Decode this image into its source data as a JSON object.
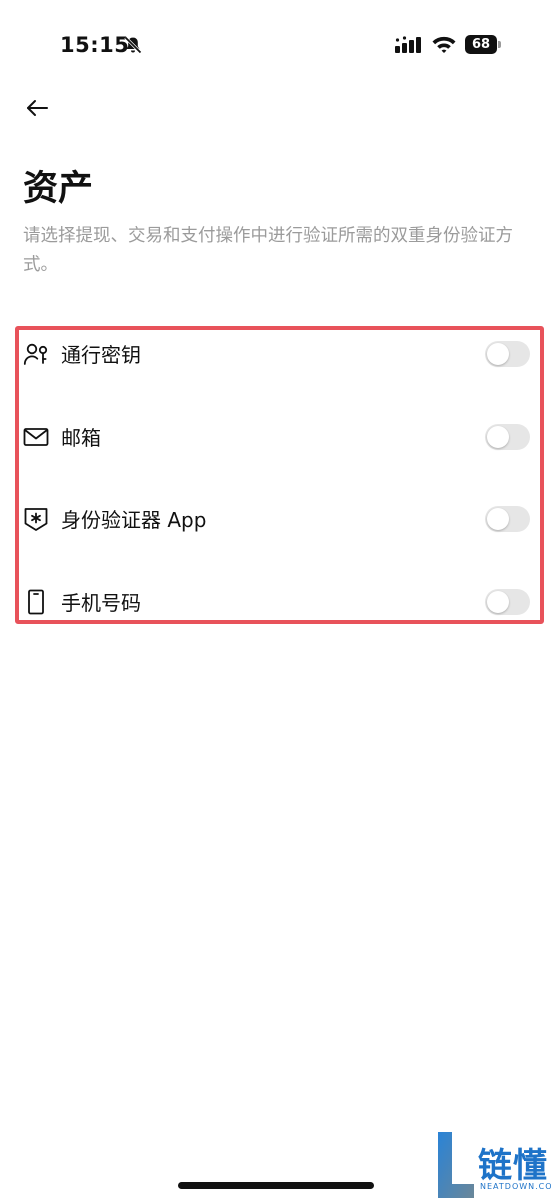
{
  "status_bar": {
    "time": "15:15",
    "battery": "68",
    "icons": [
      "bell-slash-icon",
      "signal-icon",
      "wifi-icon",
      "battery-icon"
    ]
  },
  "header": {
    "back_icon": "arrow-left-icon",
    "title": "资产",
    "description": "请选择提现、交易和支付操作中进行验证所需的双重身份验证方式。"
  },
  "options": [
    {
      "label": "通行密钥",
      "icon": "passkey-icon",
      "enabled": false
    },
    {
      "label": "邮箱",
      "icon": "mail-icon",
      "enabled": false
    },
    {
      "label": "身份验证器 App",
      "icon": "authenticator-shield-icon",
      "enabled": false
    },
    {
      "label": "手机号码",
      "icon": "phone-icon",
      "enabled": false
    }
  ],
  "watermark": {
    "text": "链懂",
    "sub": "NEATDOWN.COM"
  },
  "colors": {
    "highlight_border": "#e8525a",
    "toggle_off": "#e6e6e6",
    "description_text": "#9b9b9b",
    "watermark": "#1e73c8"
  }
}
